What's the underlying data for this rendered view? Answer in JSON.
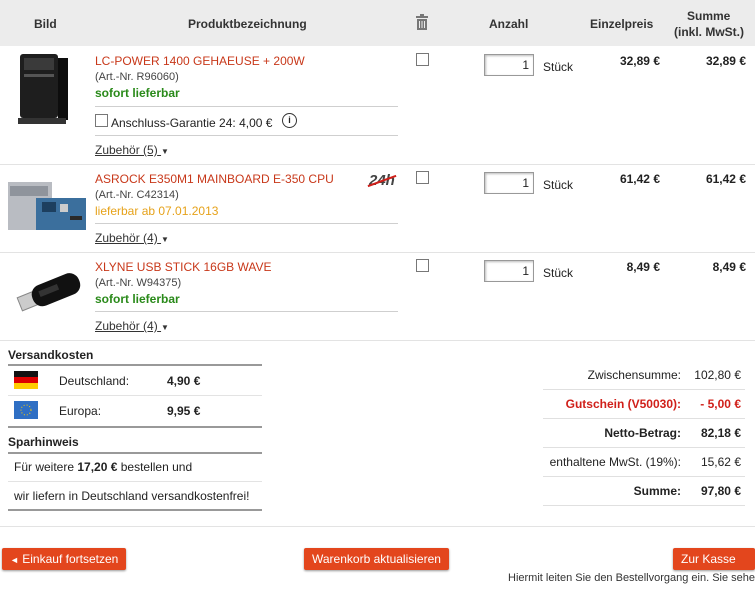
{
  "header": {
    "col_image": "Bild",
    "col_product": "Produktbezeichnung",
    "col_qty": "Anzahl",
    "col_unit_price": "Einzelpreis",
    "col_sum_line1": "Summe",
    "col_sum_line2": "(inkl. MwSt.)"
  },
  "items": [
    {
      "name": "LC-POWER 1400 GEHAEUSE + 200W",
      "artnr": "(Art.-Nr. R96060)",
      "availability": "sofort lieferbar",
      "guarantee": "Anschluss-Garantie 24: 4,00 €",
      "accessories": "Zubehör (5)",
      "qty": "1",
      "unit": "Stück",
      "unit_price": "32,89 €",
      "sum": "32,89 €"
    },
    {
      "name": "ASROCK E350M1 MAINBOARD E-350 CPU",
      "artnr": "(Art.-Nr. C42314)",
      "availability": "lieferbar ab 07.01.2013",
      "badge": "24h",
      "accessories": "Zubehör (4)",
      "qty": "1",
      "unit": "Stück",
      "unit_price": "61,42 €",
      "sum": "61,42 €"
    },
    {
      "name": "XLYNE USB STICK 16GB WAVE",
      "artnr": "(Art.-Nr. W94375)",
      "availability": "sofort lieferbar",
      "accessories": "Zubehör (4)",
      "qty": "1",
      "unit": "Stück",
      "unit_price": "8,49 €",
      "sum": "8,49 €"
    }
  ],
  "shipping": {
    "title": "Versandkosten",
    "de_label": "Deutschland:",
    "de_price": "4,90 €",
    "eu_label": "Europa:",
    "eu_price": "9,95 €"
  },
  "savings": {
    "title": "Sparhinweis",
    "line1_pre": "Für weitere ",
    "line1_amount": "17,20 €",
    "line1_post": " bestellen und",
    "line2": "wir liefern in Deutschland versandkostenfrei!"
  },
  "totals": {
    "subtotal_label": "Zwischensumme:",
    "subtotal": "102,80 €",
    "voucher_label": "Gutschein (V50030):",
    "voucher": "- 5,00 €",
    "net_label": "Netto-Betrag:",
    "net": "82,18 €",
    "vat_label": "enthaltene MwSt. (19%):",
    "vat": "15,62 €",
    "total_label": "Summe:",
    "total": "97,80 €"
  },
  "buttons": {
    "continue": "Einkauf fortsetzen",
    "update": "Warenkorb aktualisieren",
    "checkout": "Zur Kasse"
  },
  "footer_text": "Hiermit leiten Sie den Bestellvorgang ein. Sie sehen",
  "colors": {
    "accent": "#e3461d",
    "product": "#c8381a",
    "green": "#2a8a1a",
    "orange": "#e6a21a",
    "voucher": "#d0201a"
  }
}
